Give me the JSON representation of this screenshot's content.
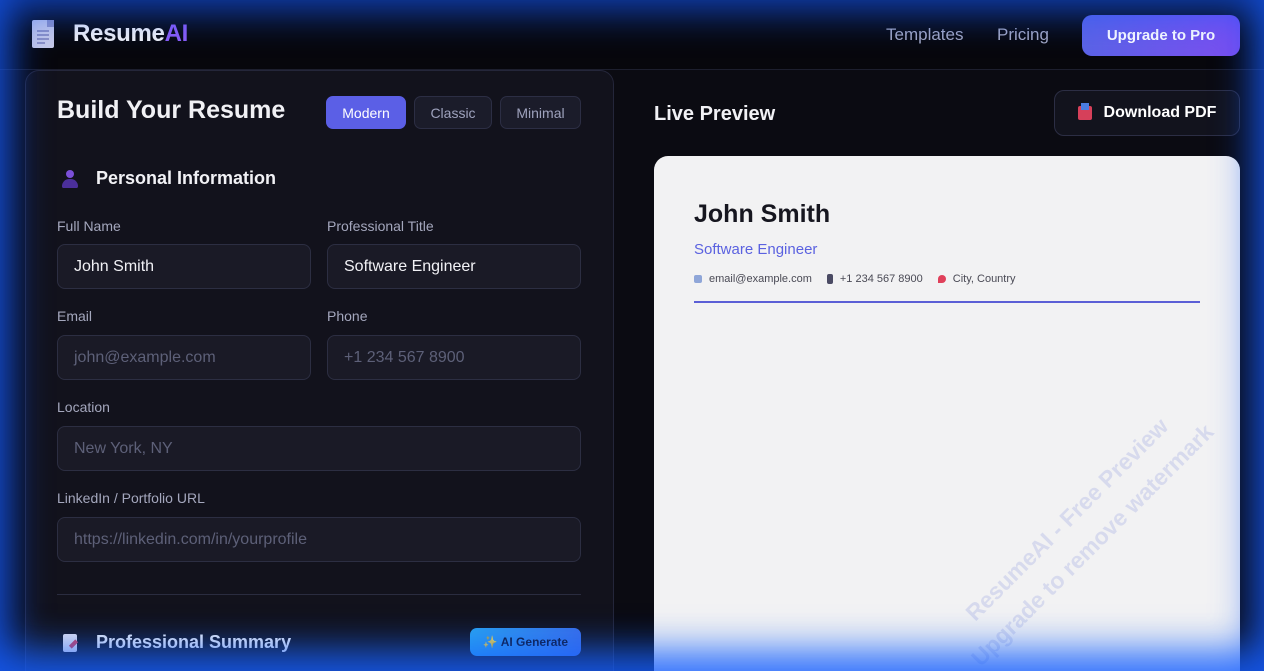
{
  "header": {
    "brand_main": "Resume",
    "brand_accent": "AI",
    "nav": [
      "Templates",
      "Pricing"
    ],
    "upgrade_label": "Upgrade to Pro"
  },
  "builder": {
    "title": "Build Your Resume",
    "templates": [
      {
        "label": "Modern",
        "active": true
      },
      {
        "label": "Classic",
        "active": false
      },
      {
        "label": "Minimal",
        "active": false
      }
    ],
    "personal": {
      "heading": "Personal Information",
      "full_name_label": "Full Name",
      "full_name_value": "John Smith",
      "title_label": "Professional Title",
      "title_value": "Software Engineer",
      "email_label": "Email",
      "email_placeholder": "john@example.com",
      "phone_label": "Phone",
      "phone_placeholder": "+1 234 567 8900",
      "location_label": "Location",
      "location_placeholder": "New York, NY",
      "url_label": "LinkedIn / Portfolio URL",
      "url_placeholder": "https://linkedin.com/in/yourprofile"
    },
    "summary": {
      "heading": "Professional Summary",
      "ai_button": "✨ AI Generate"
    }
  },
  "preview": {
    "title": "Live Preview",
    "download_label": "Download PDF",
    "resume": {
      "name": "John Smith",
      "title": "Software Engineer",
      "email": "email@example.com",
      "phone": "+1 234 567 8900",
      "location": "City, Country"
    },
    "watermark_line1": "ResumeAI - Free Preview",
    "watermark_line2": "Upgrade to remove watermark"
  },
  "colors": {
    "accent": "#5b5fe6",
    "brand_ai": "#8b5cf6",
    "glow": "#145aff"
  }
}
